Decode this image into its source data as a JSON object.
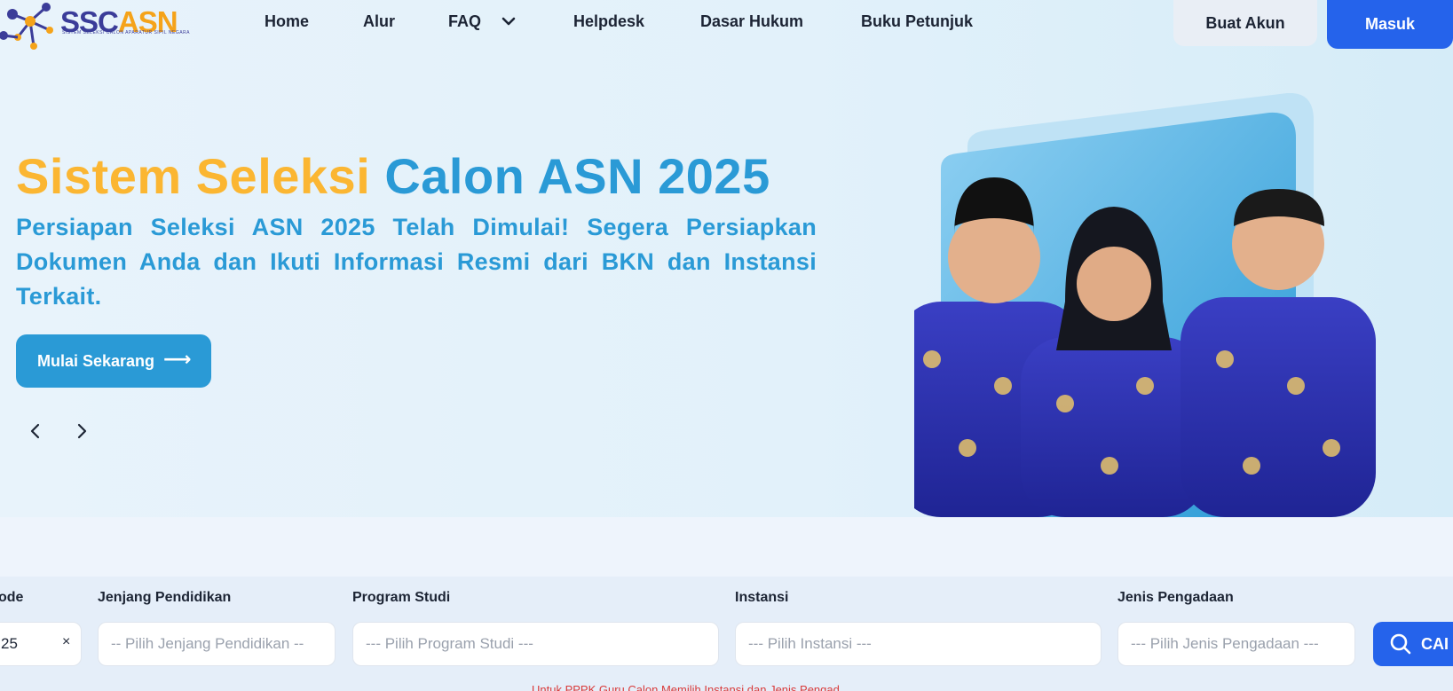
{
  "header": {
    "logo": {
      "brand_a": "SSC",
      "brand_b": "ASN",
      "tagline": "SISTEM SELEKSI CALON APARATUR SIPIL NEGARA"
    },
    "nav": [
      {
        "label": "Home"
      },
      {
        "label": "Alur"
      },
      {
        "label": "FAQ"
      },
      {
        "label": "Helpdesk"
      },
      {
        "label": "Dasar Hukum"
      },
      {
        "label": "Buku Petunjuk"
      }
    ],
    "buat_akun": "Buat Akun",
    "masuk": "Masuk"
  },
  "hero": {
    "title_part1": "Sistem Seleksi",
    "title_part2": "Calon ASN 2025",
    "subtitle": "Persiapan Seleksi ASN 2025 Telah Dimulai! Segera Persiapkan Dokumen Anda dan Ikuti Informasi Resmi dari BKN dan Instansi Terkait.",
    "cta": "Mulai Sekarang"
  },
  "filters": {
    "periode": {
      "label": "ode",
      "value": "25"
    },
    "jenjang": {
      "label": "Jenjang Pendidikan",
      "placeholder": "-- Pilih Jenjang Pendidikan --"
    },
    "prodi": {
      "label": "Program Studi",
      "placeholder": "--- Pilih Program Studi ---"
    },
    "instansi": {
      "label": "Instansi",
      "placeholder": "--- Pilih Instansi ---"
    },
    "pengadaan": {
      "label": "Jenis Pengadaan",
      "placeholder": "--- Pilih Jenis Pengadaan ---"
    },
    "search_button": "CAI"
  },
  "note": "Untuk PPPK Guru Calon Memilih Instansi dan Jenis Pengad",
  "colors": {
    "primary": "#2563eb",
    "accent_blue": "#2a9ad6",
    "accent_yellow": "#fbb632",
    "brand_navy": "#3b3c99"
  }
}
